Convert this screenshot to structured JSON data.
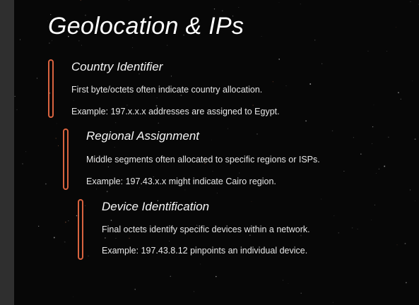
{
  "slide": {
    "title": "Geolocation & IPs",
    "accent_color": "#d9633f",
    "background_color": "#070707",
    "items": [
      {
        "heading": "Country Identifier",
        "line1": "First byte/octets often indicate country allocation.",
        "line2": "Example: 197.x.x.x addresses are assigned to Egypt."
      },
      {
        "heading": "Regional Assignment",
        "line1": "Middle segments often allocated to specific regions or ISPs.",
        "line2": "Example: 197.43.x.x might indicate Cairo region."
      },
      {
        "heading": "Device Identification",
        "line1": "Final octets identify specific devices within a network.",
        "line2": "Example: 197.43.8.12 pinpoints an individual device."
      }
    ]
  }
}
